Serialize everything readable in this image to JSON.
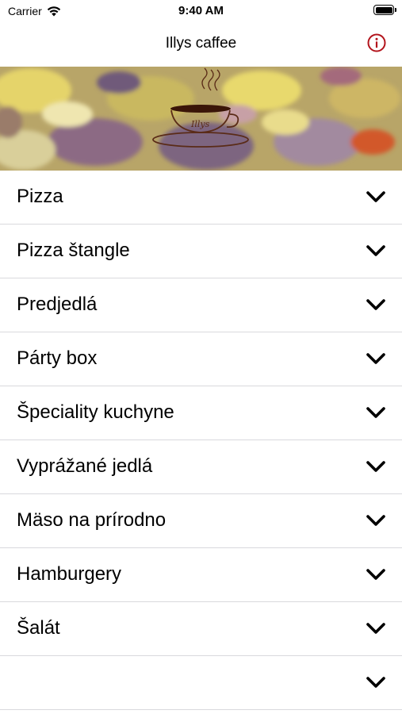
{
  "status_bar": {
    "carrier": "Carrier",
    "time": "9:40 AM",
    "icons": [
      "wifi-icon",
      "battery-icon"
    ]
  },
  "nav": {
    "title": "Illys caffee",
    "info_icon": "info-icon",
    "accent_color": "#b3141c"
  },
  "hero": {
    "logo_text": "Illys"
  },
  "menu": {
    "items": [
      {
        "label": "Pizza",
        "icon": "chevron-down-icon"
      },
      {
        "label": "Pizza štangle",
        "icon": "chevron-down-icon"
      },
      {
        "label": "Predjedlá",
        "icon": "chevron-down-icon"
      },
      {
        "label": "Párty box",
        "icon": "chevron-down-icon"
      },
      {
        "label": "Špeciality kuchyne",
        "icon": "chevron-down-icon"
      },
      {
        "label": "Vyprážané jedlá",
        "icon": "chevron-down-icon"
      },
      {
        "label": "Mäso na prírodno",
        "icon": "chevron-down-icon"
      },
      {
        "label": "Hamburgery",
        "icon": "chevron-down-icon"
      },
      {
        "label": "Šalát",
        "icon": "chevron-down-icon"
      },
      {
        "label": "",
        "icon": "chevron-down-icon"
      }
    ]
  }
}
